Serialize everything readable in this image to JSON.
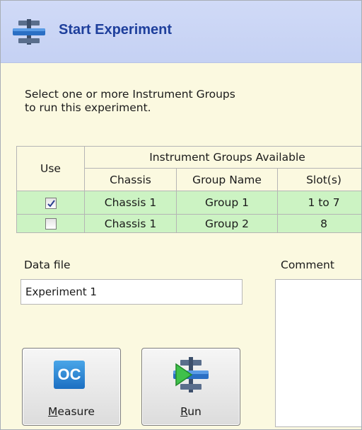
{
  "window": {
    "title": "Start Experiment",
    "title_icon": "experiment-icon"
  },
  "instructions": {
    "line1": "Select one or more Instrument Groups",
    "line2": "to run this experiment."
  },
  "groups_table": {
    "use_header": "Use",
    "group_header": "Instrument Groups Available",
    "columns": [
      "Chassis",
      "Group Name",
      "Slot(s)"
    ],
    "rows": [
      {
        "checked": true,
        "chassis": "Chassis 1",
        "group": "Group 1",
        "slots": "1 to 7"
      },
      {
        "checked": false,
        "chassis": "Chassis 1",
        "group": "Group 2",
        "slots": "8"
      }
    ]
  },
  "data_file": {
    "label": "Data file",
    "value": "Experiment 1"
  },
  "comment": {
    "label": "Comment",
    "value": ""
  },
  "buttons": {
    "measure": {
      "label": "Measure",
      "mnemonic": "M",
      "rest": "easure",
      "icon": "oc-icon",
      "icon_text": "OC"
    },
    "run": {
      "label": "Run",
      "mnemonic": "R",
      "rest": "un",
      "icon": "run-icon"
    }
  },
  "colors": {
    "window_bg": "#fbf9e0",
    "header_bg": "#c5d1f3",
    "title_color": "#1e3f9c",
    "row_highlight": "#ccf3c3"
  }
}
